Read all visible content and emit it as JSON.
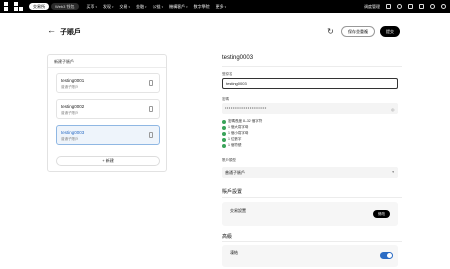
{
  "topbar": {
    "tabs": [
      "交易所",
      "Web3 钱包"
    ],
    "nav": [
      "买币",
      "发现",
      "交易",
      "金融",
      "公链",
      "機構客戶",
      "数字學院",
      "更多"
    ],
    "account": "调度管理"
  },
  "header": {
    "title": "子賬戶",
    "outline_button": "保存並重複",
    "primary_button": "提交"
  },
  "left": {
    "title": "新建子賬戶",
    "accounts": [
      {
        "name": "testing0001",
        "type": "普通子賬戶"
      },
      {
        "name": "testing0002",
        "type": "普通子賬戶"
      },
      {
        "name": "testing0003",
        "type": "普通子賬戶"
      }
    ],
    "selected_index": 2,
    "new_button": "新建"
  },
  "form": {
    "heading": "testing0003",
    "username_label": "登錄名",
    "username_value": "testing0003",
    "password_label": "密碼",
    "password_value": "••••••••••••••••••••••",
    "rules": [
      "密碼長度 8–32 個字符",
      "1 個大寫字母",
      "1 個小寫字母",
      "1 位數字",
      "1 個符號"
    ],
    "type_label": "賬戶類型",
    "type_value": "普通子賬戶",
    "section_settings": "賬戶設置",
    "trading_title": "交易設置",
    "trading_desc": "",
    "edit_button": "修改",
    "section_advanced": "高級",
    "toggle_title": "凍結",
    "toggle_desc": "",
    "toggle_on": true
  }
}
